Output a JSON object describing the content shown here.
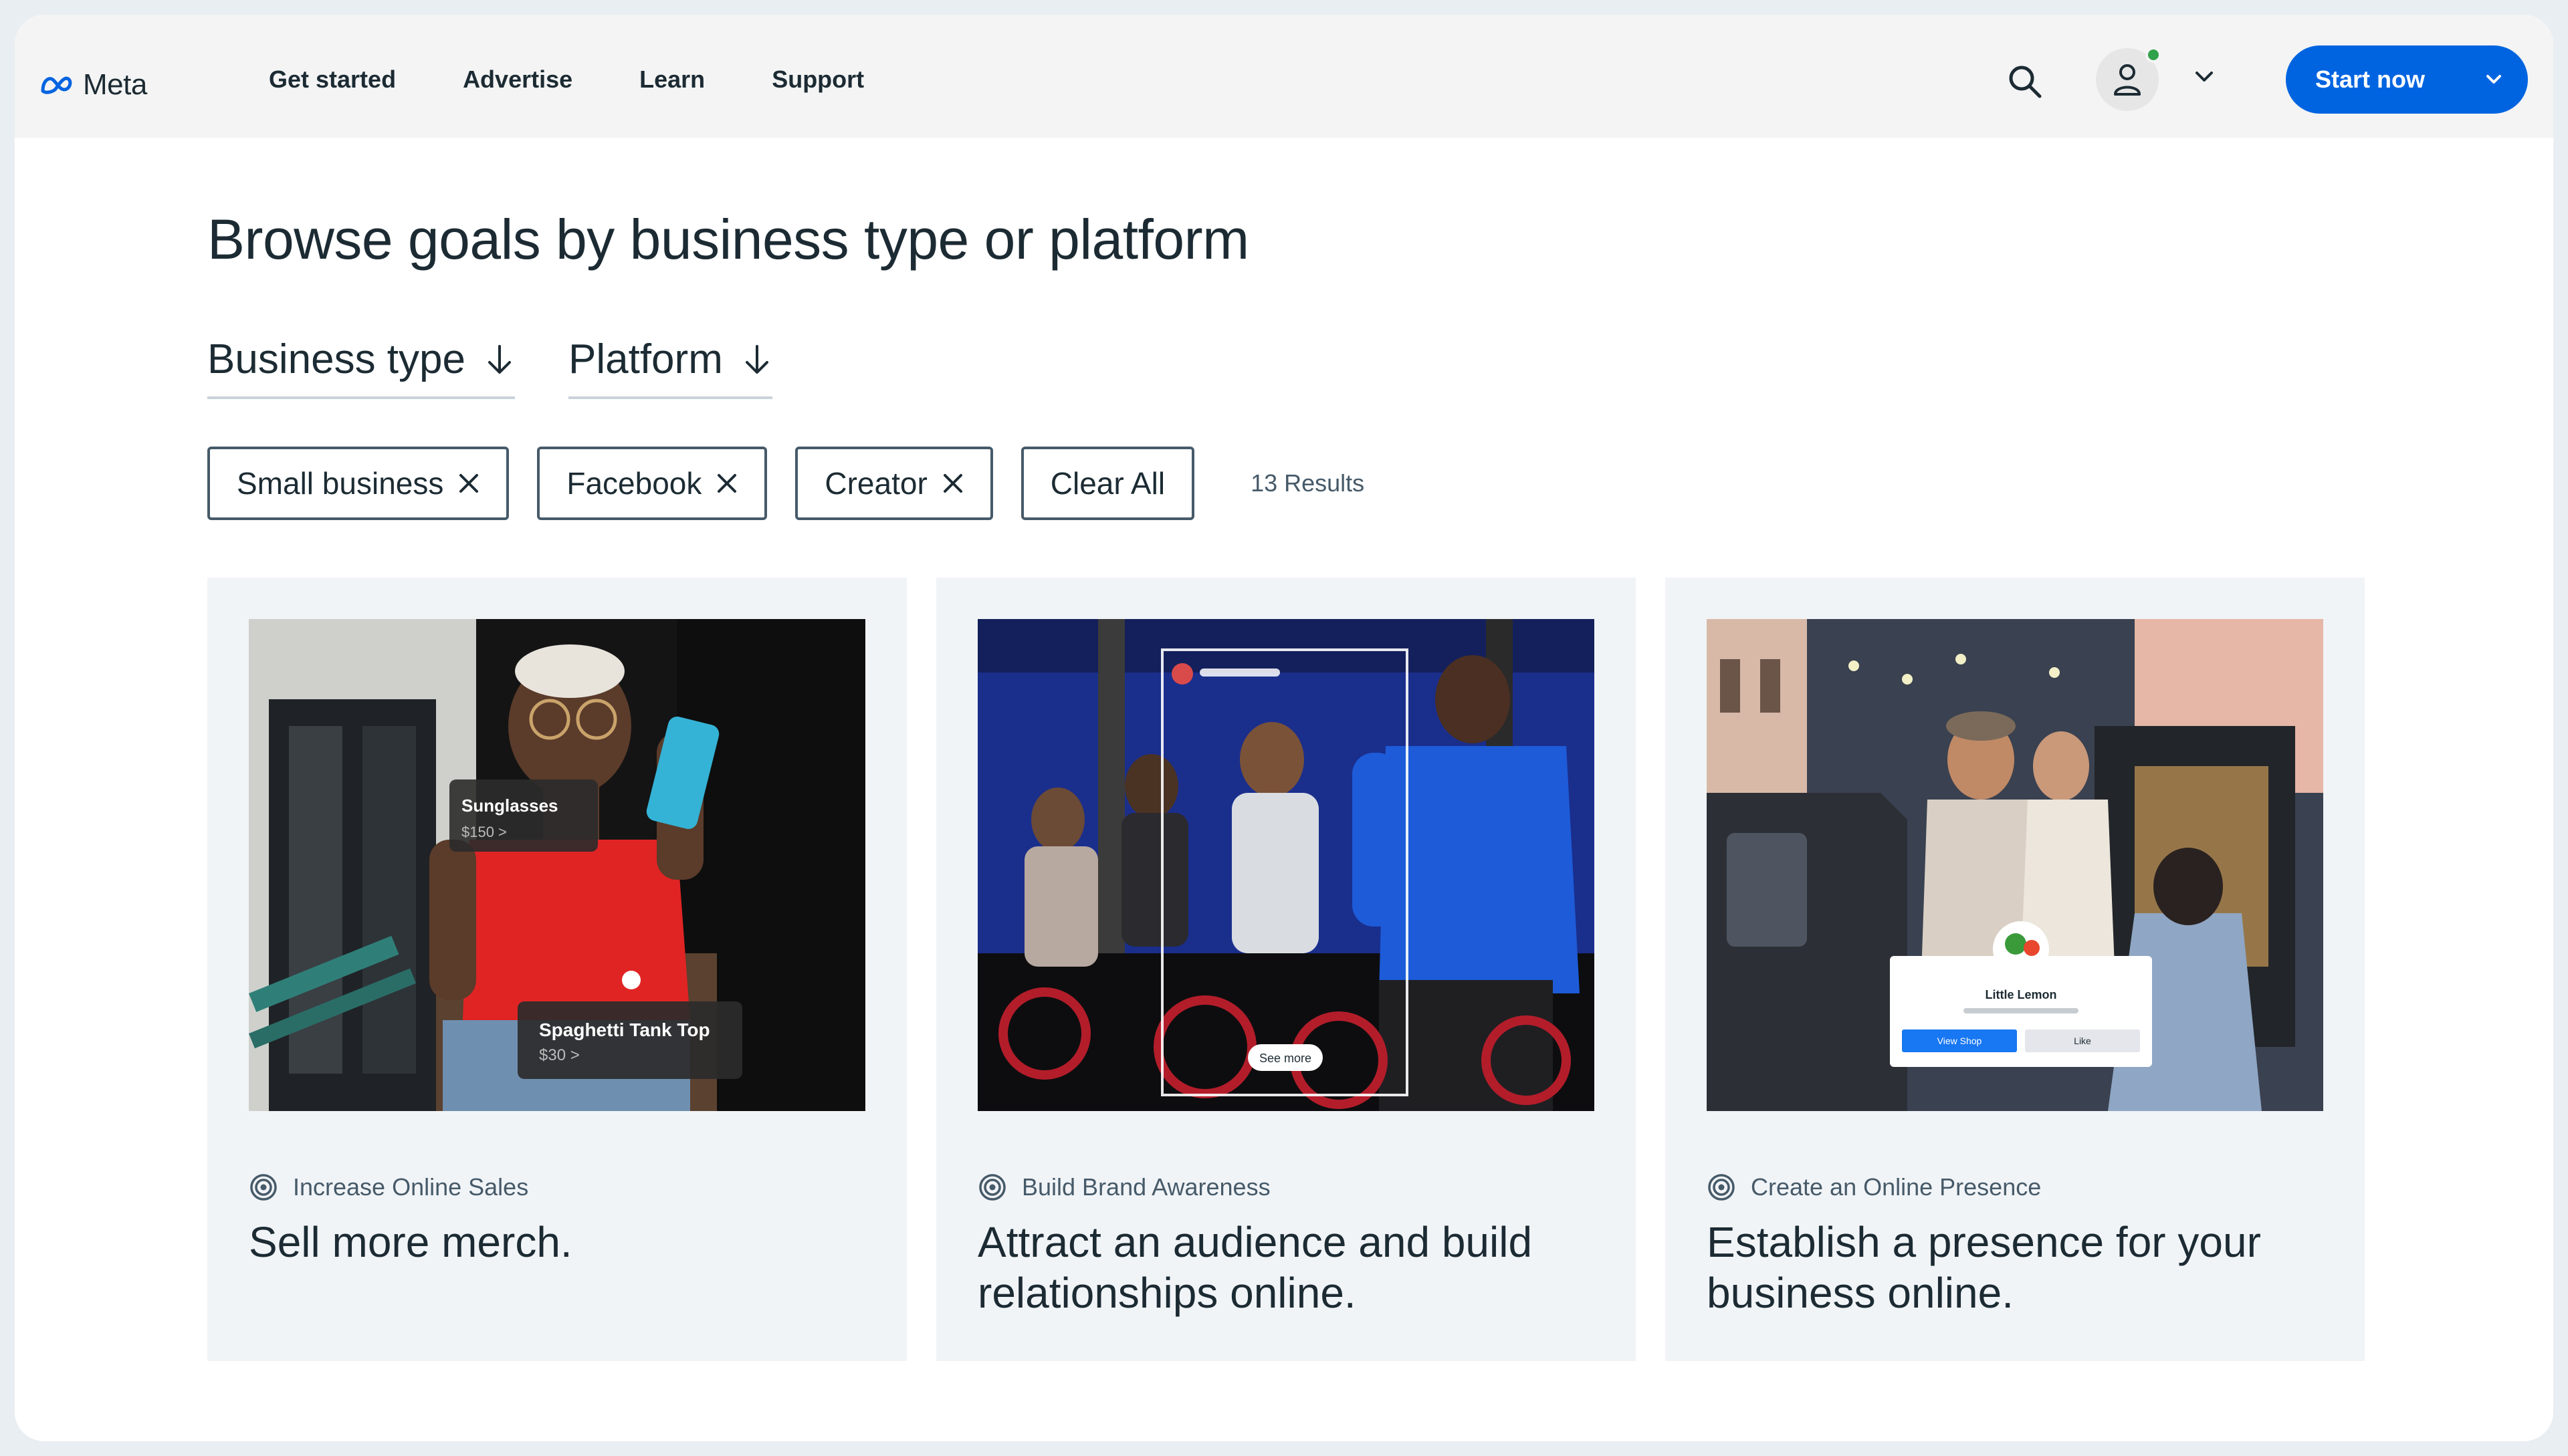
{
  "header": {
    "logo_text": "Meta",
    "nav": [
      "Get started",
      "Advertise",
      "Learn",
      "Support"
    ],
    "start_button": "Start now"
  },
  "main": {
    "title": "Browse goals by business type or platform",
    "dropdowns": [
      "Business type",
      "Platform"
    ],
    "filters": [
      "Small business",
      "Facebook",
      "Creator"
    ],
    "clear_all": "Clear All",
    "results": "13 Results"
  },
  "cards": [
    {
      "tag": "Increase Online Sales",
      "headline": "Sell more merch.",
      "overlay": {
        "item1_name": "Sunglasses",
        "item1_price": "$150 >",
        "item2_name": "Spaghetti Tank Top",
        "item2_price": "$30 >"
      }
    },
    {
      "tag": "Build Brand Awareness",
      "headline": "Attract an audience and build relationships online.",
      "overlay": {
        "cta": "See more"
      }
    },
    {
      "tag": "Create an Online Presence",
      "headline": "Establish a presence for your business online.",
      "overlay": {
        "page_name": "Little Lemon",
        "button1": "View Shop",
        "button2": "Like"
      }
    }
  ],
  "colors": {
    "accent": "#0064e0",
    "text": "#1c2b33",
    "card_bg": "#f1f4f7",
    "status_online": "#31a24c"
  },
  "icons": [
    "meta-logo-icon",
    "search-icon",
    "user-icon",
    "chevron-down-icon",
    "arrow-down-icon",
    "close-icon",
    "target-icon"
  ]
}
